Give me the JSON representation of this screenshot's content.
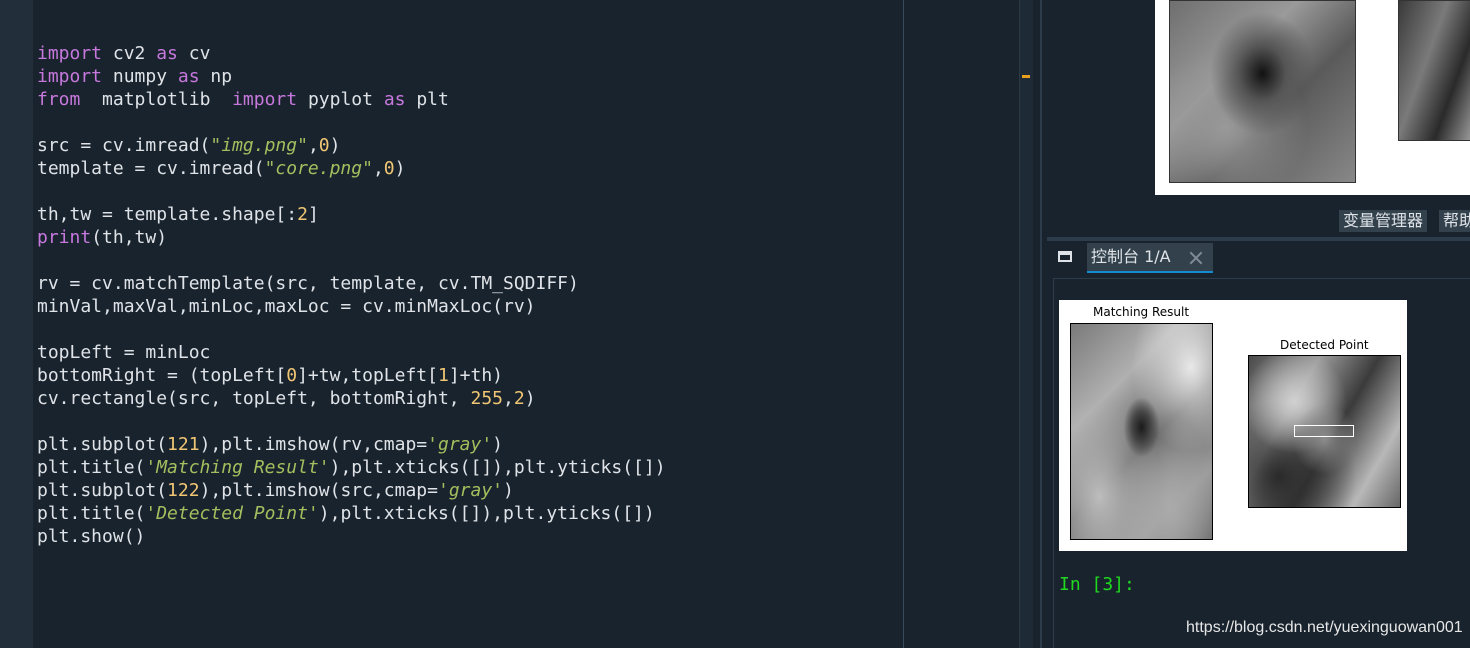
{
  "editor": {
    "lines": [
      [
        {
          "t": "import",
          "c": "kw"
        },
        {
          "t": " cv2 ",
          "c": ""
        },
        {
          "t": "as",
          "c": "kw"
        },
        {
          "t": " cv",
          "c": ""
        }
      ],
      [
        {
          "t": "import",
          "c": "kw"
        },
        {
          "t": " numpy ",
          "c": ""
        },
        {
          "t": "as",
          "c": "kw"
        },
        {
          "t": " np",
          "c": ""
        }
      ],
      [
        {
          "t": "from",
          "c": "kw"
        },
        {
          "t": "  matplotlib  ",
          "c": ""
        },
        {
          "t": "import",
          "c": "kw"
        },
        {
          "t": " pyplot ",
          "c": ""
        },
        {
          "t": "as",
          "c": "kw"
        },
        {
          "t": " plt",
          "c": ""
        }
      ],
      [],
      [
        {
          "t": "src = cv.imread(",
          "c": ""
        },
        {
          "t": "\"img.png\"",
          "c": "str"
        },
        {
          "t": ",",
          "c": ""
        },
        {
          "t": "0",
          "c": "num"
        },
        {
          "t": ")",
          "c": ""
        }
      ],
      [
        {
          "t": "template = cv.imread(",
          "c": ""
        },
        {
          "t": "\"core.png\"",
          "c": "str"
        },
        {
          "t": ",",
          "c": ""
        },
        {
          "t": "0",
          "c": "num"
        },
        {
          "t": ")",
          "c": ""
        }
      ],
      [],
      [
        {
          "t": "th,tw = template.shape[:",
          "c": ""
        },
        {
          "t": "2",
          "c": "num"
        },
        {
          "t": "]",
          "c": ""
        }
      ],
      [
        {
          "t": "print",
          "c": "kw"
        },
        {
          "t": "(th,tw)",
          "c": ""
        }
      ],
      [],
      [
        {
          "t": "rv = cv.matchTemplate(src, template, cv.TM_SQDIFF)",
          "c": ""
        }
      ],
      [
        {
          "t": "minVal,maxVal,minLoc,maxLoc = cv.minMaxLoc(rv)",
          "c": ""
        }
      ],
      [],
      [
        {
          "t": "topLeft = minLoc",
          "c": ""
        }
      ],
      [
        {
          "t": "bottomRight = (topLeft[",
          "c": ""
        },
        {
          "t": "0",
          "c": "num"
        },
        {
          "t": "]+tw,topLeft[",
          "c": ""
        },
        {
          "t": "1",
          "c": "num"
        },
        {
          "t": "]+th)",
          "c": ""
        }
      ],
      [
        {
          "t": "cv.rectangle(src, topLeft, bottomRight, ",
          "c": ""
        },
        {
          "t": "255",
          "c": "num"
        },
        {
          "t": ",",
          "c": ""
        },
        {
          "t": "2",
          "c": "num"
        },
        {
          "t": ")",
          "c": ""
        }
      ],
      [],
      [
        {
          "t": "plt.subplot(",
          "c": ""
        },
        {
          "t": "121",
          "c": "num"
        },
        {
          "t": "),plt.imshow(rv,cmap=",
          "c": ""
        },
        {
          "t": "'gray'",
          "c": "str"
        },
        {
          "t": ")",
          "c": ""
        }
      ],
      [
        {
          "t": "plt.title(",
          "c": ""
        },
        {
          "t": "'Matching Result'",
          "c": "str"
        },
        {
          "t": "),plt.xticks([]),plt.yticks([])",
          "c": ""
        }
      ],
      [
        {
          "t": "plt.subplot(",
          "c": ""
        },
        {
          "t": "122",
          "c": "num"
        },
        {
          "t": "),plt.imshow(src,cmap=",
          "c": ""
        },
        {
          "t": "'gray'",
          "c": "str"
        },
        {
          "t": ")",
          "c": ""
        }
      ],
      [
        {
          "t": "plt.title(",
          "c": ""
        },
        {
          "t": "'Detected Point'",
          "c": "str"
        },
        {
          "t": "),plt.xticks([]),plt.yticks([])",
          "c": ""
        }
      ],
      [
        {
          "t": "plt.show()",
          "c": ""
        }
      ]
    ]
  },
  "right_tabs": {
    "variable_explorer": "变量管理器",
    "help": "帮助"
  },
  "console": {
    "tab_label": "控制台 1/A",
    "prompt": "In [3]:"
  },
  "figure": {
    "title_left": "Matching Result",
    "title_right": "Detected Point"
  },
  "watermark": "https://blog.csdn.net/yuexinguowan001",
  "colors": {
    "background": "#19232d",
    "keyword": "#c678dd",
    "string": "#a3be5e",
    "number": "#f0c674",
    "prompt": "#1fd81f",
    "tab_accent": "#148cd2"
  }
}
